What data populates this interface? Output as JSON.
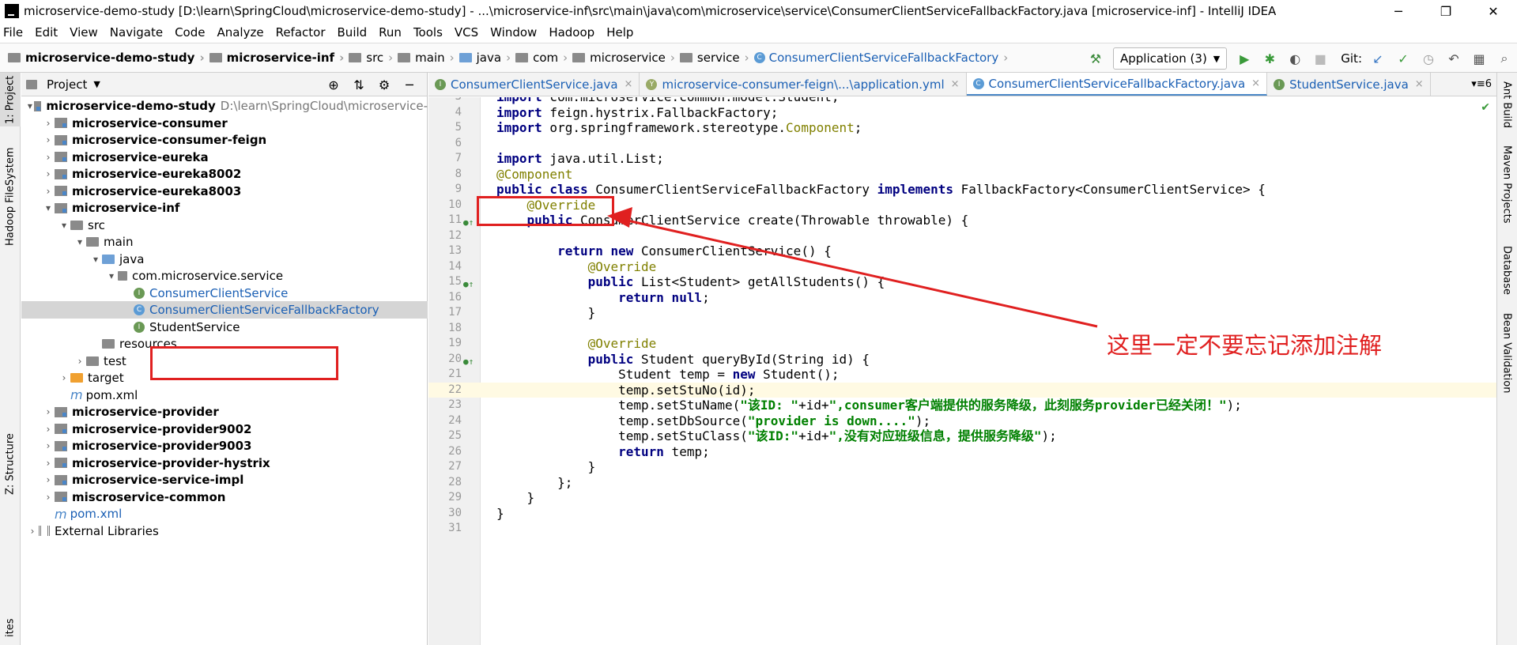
{
  "window": {
    "title": "microservice-demo-study [D:\\learn\\SpringCloud\\microservice-demo-study] - ...\\microservice-inf\\src\\main\\java\\com\\microservice\\service\\ConsumerClientServiceFallbackFactory.java [microservice-inf] - IntelliJ IDEA",
    "minimize": "─",
    "maximize": "❐",
    "close": "✕"
  },
  "menu": [
    "File",
    "Edit",
    "View",
    "Navigate",
    "Code",
    "Analyze",
    "Refactor",
    "Build",
    "Run",
    "Tools",
    "VCS",
    "Window",
    "Hadoop",
    "Help"
  ],
  "breadcrumb": [
    "microservice-demo-study",
    "microservice-inf",
    "src",
    "main",
    "java",
    "com",
    "microservice",
    "service",
    "ConsumerClientServiceFallbackFactory"
  ],
  "toolbar": {
    "run_config": "Application (3)",
    "git_label": "Git:"
  },
  "left_tabs": [
    "1: Project",
    "Hadoop FileSystem",
    "Z: Structure",
    "ites"
  ],
  "right_tabs": [
    "Ant Build",
    "Maven Projects",
    "Database",
    "Bean Validation"
  ],
  "project_panel": {
    "title": "Project",
    "tree": [
      {
        "label": "microservice-demo-study",
        "path": "D:\\learn\\SpringCloud\\microservice-",
        "depth": 0,
        "arrow": "▾",
        "icon": "module",
        "bold": true
      },
      {
        "label": "microservice-consumer",
        "depth": 1,
        "arrow": "›",
        "icon": "module",
        "bold": true
      },
      {
        "label": "microservice-consumer-feign",
        "depth": 1,
        "arrow": "›",
        "icon": "module",
        "bold": true
      },
      {
        "label": "microservice-eureka",
        "depth": 1,
        "arrow": "›",
        "icon": "module",
        "bold": true
      },
      {
        "label": "microservice-eureka8002",
        "depth": 1,
        "arrow": "›",
        "icon": "module",
        "bold": true
      },
      {
        "label": "microservice-eureka8003",
        "depth": 1,
        "arrow": "›",
        "icon": "module",
        "bold": true
      },
      {
        "label": "microservice-inf",
        "depth": 1,
        "arrow": "▾",
        "icon": "module",
        "bold": true
      },
      {
        "label": "src",
        "depth": 2,
        "arrow": "▾",
        "icon": "folder"
      },
      {
        "label": "main",
        "depth": 3,
        "arrow": "▾",
        "icon": "folder"
      },
      {
        "label": "java",
        "depth": 4,
        "arrow": "▾",
        "icon": "folder-blue"
      },
      {
        "label": "com.microservice.service",
        "depth": 5,
        "arrow": "▾",
        "icon": "package"
      },
      {
        "label": "ConsumerClientService",
        "depth": 6,
        "arrow": "",
        "icon": "interface",
        "blue": true
      },
      {
        "label": "ConsumerClientServiceFallbackFactory",
        "depth": 6,
        "arrow": "",
        "icon": "class",
        "blue": true,
        "selected": true
      },
      {
        "label": "StudentService",
        "depth": 6,
        "arrow": "",
        "icon": "interface"
      },
      {
        "label": "resources",
        "depth": 4,
        "arrow": "",
        "icon": "folder"
      },
      {
        "label": "test",
        "depth": 3,
        "arrow": "›",
        "icon": "folder"
      },
      {
        "label": "target",
        "depth": 2,
        "arrow": "›",
        "icon": "folder-orange"
      },
      {
        "label": "pom.xml",
        "depth": 2,
        "arrow": "",
        "icon": "maven"
      },
      {
        "label": "microservice-provider",
        "depth": 1,
        "arrow": "›",
        "icon": "module",
        "bold": true
      },
      {
        "label": "microservice-provider9002",
        "depth": 1,
        "arrow": "›",
        "icon": "module",
        "bold": true
      },
      {
        "label": "microservice-provider9003",
        "depth": 1,
        "arrow": "›",
        "icon": "module",
        "bold": true
      },
      {
        "label": "microservice-provider-hystrix",
        "depth": 1,
        "arrow": "›",
        "icon": "module",
        "bold": true
      },
      {
        "label": "microservice-service-impl",
        "depth": 1,
        "arrow": "›",
        "icon": "module",
        "bold": true
      },
      {
        "label": "miscroservice-common",
        "depth": 1,
        "arrow": "›",
        "icon": "module",
        "bold": true
      },
      {
        "label": "pom.xml",
        "depth": 1,
        "arrow": "",
        "icon": "maven",
        "blue": true
      },
      {
        "label": "External Libraries",
        "depth": 0,
        "arrow": "›",
        "icon": "library"
      }
    ]
  },
  "editor_tabs": [
    {
      "label": "ConsumerClientService.java",
      "icon": "I"
    },
    {
      "label": "microservice-consumer-feign\\...\\application.yml",
      "icon": "Y"
    },
    {
      "label": "ConsumerClientServiceFallbackFactory.java",
      "icon": "C",
      "active": true
    },
    {
      "label": "StudentService.java",
      "icon": "I"
    }
  ],
  "tab_overflow": "6",
  "code_lines": [
    {
      "n": "3",
      "html": "<span class=\"kw\">import</span> com.microservice.common.model.Student;"
    },
    {
      "n": "4",
      "html": "<span class=\"kw\">import</span> feign.hystrix.FallbackFactory;"
    },
    {
      "n": "5",
      "html": "<span class=\"kw\">import</span> org.springframework.stereotype.<span class=\"cls\">Component</span>;"
    },
    {
      "n": "6",
      "html": ""
    },
    {
      "n": "7",
      "html": "<span class=\"kw\">import</span> java.util.List;"
    },
    {
      "n": "8",
      "html": "<span class=\"an\">@Component</span>"
    },
    {
      "n": "9",
      "html": "<span class=\"kw\">public class</span> ConsumerClientServiceFallbackFactory <span class=\"kw\">implements</span> FallbackFactory&lt;ConsumerClientService&gt; {"
    },
    {
      "n": "10",
      "html": "    <span class=\"an\">@Override</span>"
    },
    {
      "n": "11",
      "html": "    <span class=\"kw\">public</span> ConsumerClientService create(Throwable throwable) {",
      "mark": true
    },
    {
      "n": "12",
      "html": ""
    },
    {
      "n": "13",
      "html": "        <span class=\"kw\">return new</span> ConsumerClientService() {"
    },
    {
      "n": "14",
      "html": "            <span class=\"an\">@Override</span>"
    },
    {
      "n": "15",
      "html": "            <span class=\"kw\">public</span> List&lt;Student&gt; getAllStudents() {",
      "mark": true
    },
    {
      "n": "16",
      "html": "                <span class=\"kw\">return null</span>;"
    },
    {
      "n": "17",
      "html": "            }"
    },
    {
      "n": "18",
      "html": ""
    },
    {
      "n": "19",
      "html": "            <span class=\"an\">@Override</span>"
    },
    {
      "n": "20",
      "html": "            <span class=\"kw\">public</span> Student queryById(String id) {",
      "mark": true
    },
    {
      "n": "21",
      "html": "                Student temp = <span class=\"kw\">new</span> Student();"
    },
    {
      "n": "22",
      "html": "                temp.setStuNo(id);",
      "current": true
    },
    {
      "n": "23",
      "html": "                temp.setStuName(<span class=\"str\">\"该ID: \"</span>+id+<span class=\"str\">\",consumer客户端提供的服务降级，此刻服务provider已经关闭！\"</span>);"
    },
    {
      "n": "24",
      "html": "                temp.setDbSource(<span class=\"str\">\"provider is down....\"</span>);"
    },
    {
      "n": "25",
      "html": "                temp.setStuClass(<span class=\"str\">\"该ID:\"</span>+id+<span class=\"str\">\",没有对应班级信息，提供服务降级\"</span>);"
    },
    {
      "n": "26",
      "html": "                <span class=\"kw\">return</span> temp;"
    },
    {
      "n": "27",
      "html": "            }"
    },
    {
      "n": "28",
      "html": "        };"
    },
    {
      "n": "29",
      "html": "    }"
    },
    {
      "n": "30",
      "html": "}"
    },
    {
      "n": "31",
      "html": ""
    }
  ],
  "annotation": {
    "text": "这里一定不要忘记添加注解",
    "color": "#e02020"
  }
}
